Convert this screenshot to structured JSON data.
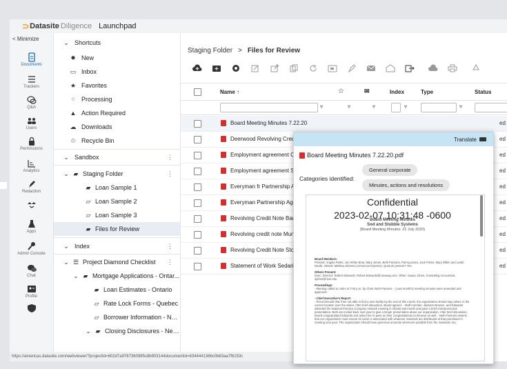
{
  "topbar": {
    "logo_mark": "⊃",
    "brand": "Datasite",
    "brand_sub": "Diligence",
    "app_title": "Launchpad"
  },
  "leftbar": {
    "minimize": "< Minimize",
    "items": [
      {
        "label": "Documents",
        "icon": "document-icon",
        "active": true
      },
      {
        "label": "Trackers",
        "icon": "list-icon"
      },
      {
        "label": "Q&A",
        "icon": "chat-bubbles-icon"
      },
      {
        "label": "Users",
        "icon": "users-icon"
      },
      {
        "label": "Permissions",
        "icon": "lock-icon"
      },
      {
        "label": "Analytics",
        "icon": "analytics-icon"
      },
      {
        "label": "Redaction",
        "icon": "pen-icon"
      },
      {
        "label": "Apps",
        "icon": "flask-icon"
      },
      {
        "label": "Admin Console",
        "icon": "wrench-icon"
      },
      {
        "label": "Chat",
        "icon": "chat-icon"
      },
      {
        "label": "Profile",
        "icon": "profile-card-icon"
      }
    ]
  },
  "shortcuts": {
    "header": "Shortcuts",
    "items": [
      {
        "label": "New",
        "icon": "new-icon"
      },
      {
        "label": "Inbox",
        "icon": "inbox-icon"
      },
      {
        "label": "Favorites",
        "icon": "star-icon"
      },
      {
        "label": "Processing",
        "icon": "processing-icon"
      },
      {
        "label": "Action Required",
        "icon": "warning-icon"
      },
      {
        "label": "Downloads",
        "icon": "cloud-download-icon"
      },
      {
        "label": "Recycle Bin",
        "icon": "recycle-icon"
      }
    ],
    "sandbox_header": "Sandbox",
    "sandbox_items": [
      {
        "label": "Staging Folder",
        "level": 0,
        "icon": "folder-icon"
      },
      {
        "label": "Loan Sample 1",
        "level": 1,
        "icon": "folder-filled-icon"
      },
      {
        "label": "Loan Sample 2",
        "level": 1,
        "icon": "folder-outline-icon"
      },
      {
        "label": "Loan Sample 3",
        "level": 1,
        "icon": "folder-outline-icon"
      },
      {
        "label": "Files for Review",
        "level": 1,
        "icon": "folder-filled-icon",
        "selected": true
      }
    ],
    "index_header": "Index",
    "index_items": [
      {
        "label": "Project Diamond Checklist",
        "level": 0,
        "icon": "checklist-icon"
      },
      {
        "label": "Mortgage Applications - Ontar...",
        "level": 1,
        "icon": "folder-icon"
      },
      {
        "label": "Loan Estimates - Ontario",
        "level": 2,
        "icon": "folder-filled-icon"
      },
      {
        "label": "Rate Lock Forms - Quebec",
        "level": 2,
        "icon": "folder-outline-icon"
      },
      {
        "label": "Borrower Information - Nov...",
        "level": 2,
        "icon": "folder-outline-icon"
      },
      {
        "label": "Closing Disclosures - New ...",
        "level": 1,
        "icon": "folder-icon"
      }
    ]
  },
  "breadcrumb": {
    "parent": "Staging Folder",
    "separator": ">",
    "current": "Files for Review"
  },
  "table": {
    "headers": {
      "name": "Name ↑",
      "index": "Index",
      "type": "Type",
      "status": "Status"
    },
    "rows": [
      {
        "name": "Board Meeting Minutes 7.22.20",
        "status": "ed"
      },
      {
        "name": "Deerwood Revolving Credit",
        "status": "ed"
      },
      {
        "name": "Employment agreement Chester",
        "status": "ed"
      },
      {
        "name": "Employment agreement Spauldi",
        "status": "ed"
      },
      {
        "name": "Everyman fr Partnership Agreem",
        "status": "ed"
      },
      {
        "name": "Everyman Partnership Agreeme",
        "status": "ed"
      },
      {
        "name": "Revolving Credit Note Barton",
        "status": "ed"
      },
      {
        "name": "Revolving credit note Munro",
        "status": "ed"
      },
      {
        "name": "Revolving Credit Note Stout",
        "status": "ed"
      },
      {
        "name": "Statement of Work Sedaris",
        "status": "ed"
      }
    ]
  },
  "modal": {
    "translate_label": "Translate",
    "file_title": "Board Meeting Minutes 7.22.20.pdf",
    "categories_label": "Categories identified:",
    "chips": [
      "General corporate",
      "Minutes, actions and resolutions"
    ],
    "preview": {
      "confidential": "Confidential",
      "timestamp": "2023-02-07 10:31:48 -0600",
      "heading1": "Board Meeting Minutes",
      "heading2": "Sod and Stubble Systems",
      "heading3": "(Board Meeting Minutes: 22 July 2020)",
      "members_title": "Board Members:",
      "members_text": "Present: Angela Parks, Jon White Bear, Mary Jones, Beth Parsons, Pat Kyumoto, Jack Porter, Mary Rifkin and Leslie Doubt. Absent: Melissa Johnson (American Express). Quorum present? Yes",
      "others_title": "Others Present:",
      "others_text": "Exec. Director: Robert Edwards, Robert.Edwards@runaway.com. Other: Susan Johns, Consulting Accountant, sjohns@river.edu",
      "proceedings_title": "Proceedings:",
      "proceedings_text": "- Meeting called to order at 7:00 p.m. by Chair, Beth Parsons. - (Last month's) meeting minutes were amended and approved.",
      "report_title": "- Chief Executive's Report:",
      "report_text": "- Recommends that if we not able to find a new facility by the end of this month, the organization should stay where in the current location over the winter. After brief discussion, Board agreed. - Staff member, Jackson Browne, and Edwards attended the National Practice Company network meeting in Atlanta last month and gave a brief entrepreneurial presentation. Both are invited back next year to give a longer presentation about our organization. After brief discussion, Board congratulated Edwards and asked her to pass on their congratulations to Browne as well. - Beth Parsons asserts that our organization must ensure its name is associated with whatever materials are distributed at that practitioner's meeting next year. The organization should have generous amounts whenever possible from the materials, too."
    }
  },
  "statusbar": {
    "url": "https://americas.datasite.com/webviewer/?projectId=602d7a9787360985c8b903144documentId=6344441366c0b63aa7f6153c"
  },
  "colors": {
    "accent": "#1565c0",
    "pdf_red": "#d32f2f",
    "translate_bar": "#c6e4f4",
    "logo": "#f39c12"
  }
}
